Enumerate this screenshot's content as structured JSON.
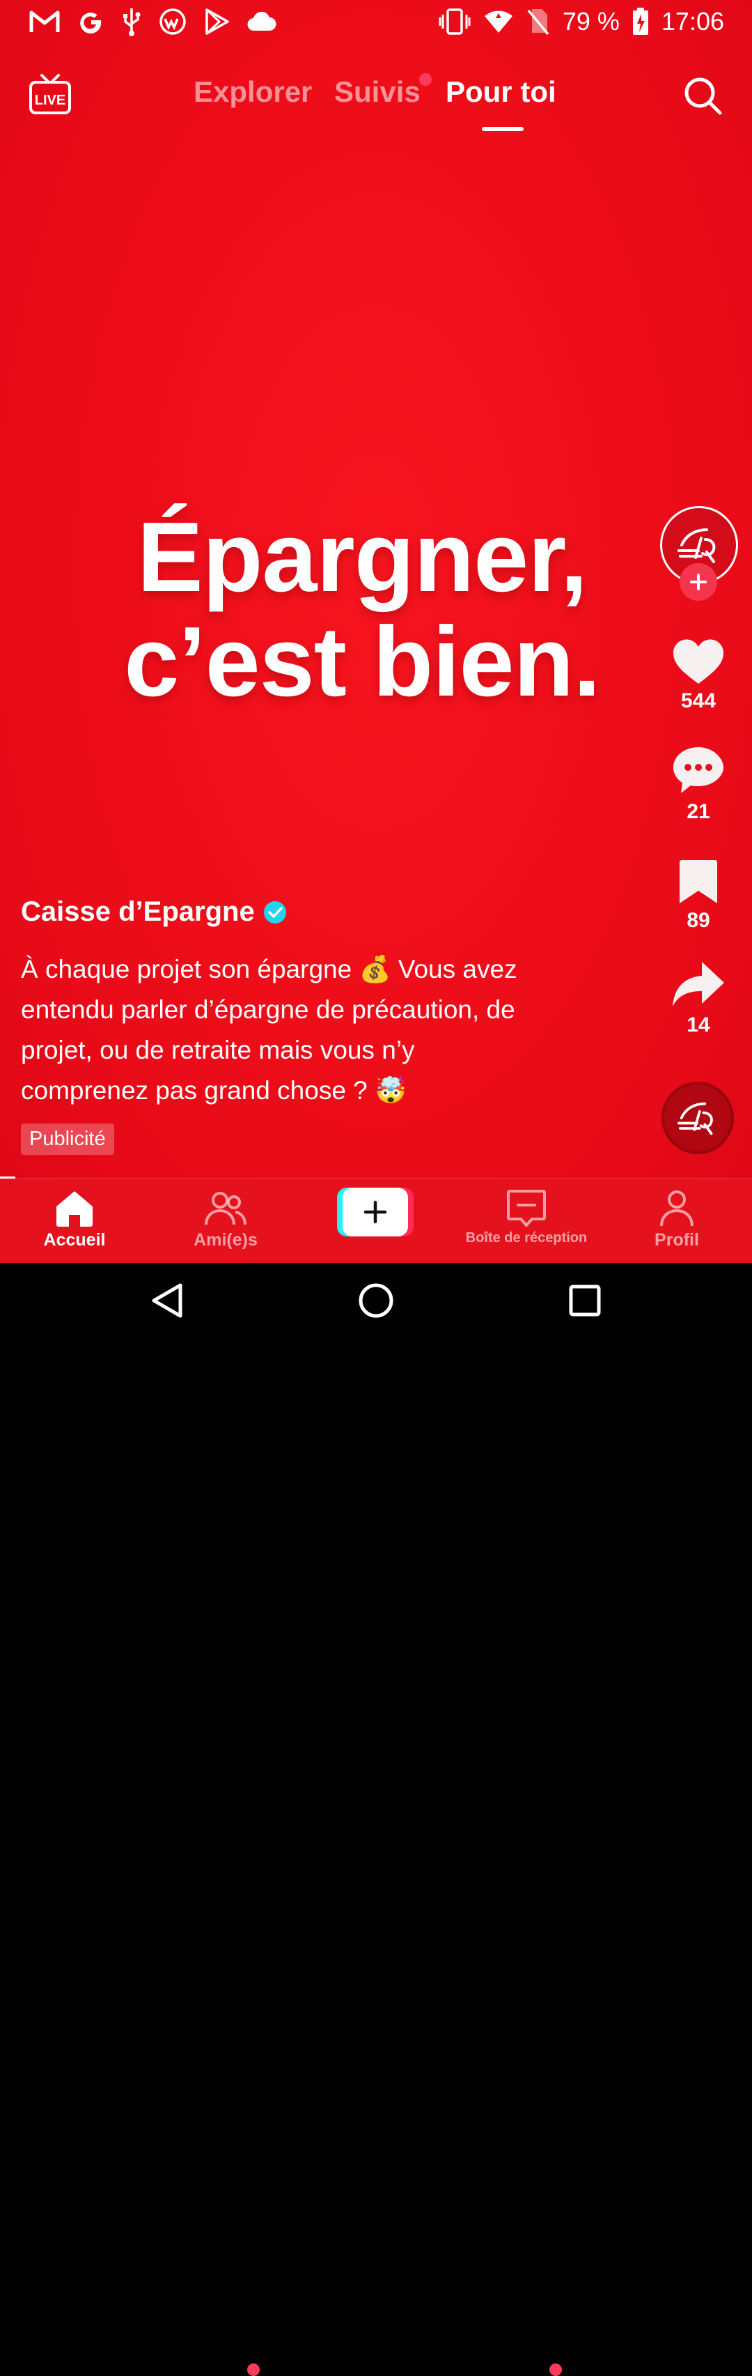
{
  "status_bar": {
    "left_icons": [
      "gmail-icon",
      "google-icon",
      "usb-icon",
      "app-icon",
      "play-store-icon",
      "cloud-icon"
    ],
    "battery": "79 %",
    "time": "17:06"
  },
  "top_nav": {
    "tabs": [
      {
        "label": "Explorer",
        "active": false
      },
      {
        "label": "Suivis",
        "active": false
      },
      {
        "label": "Pour toi",
        "active": true
      }
    ]
  },
  "video": {
    "headline_line1": "Épargner,",
    "headline_line2": "c’est bien."
  },
  "actions": {
    "likes": "544",
    "comments": "21",
    "saves": "89",
    "shares": "14"
  },
  "post": {
    "author": "Caisse d’Epargne",
    "caption_line1": "À chaque projet son épargne 💰 Vous avez",
    "caption_line2": "entendu parler d’épargne de précaution, de",
    "caption_line3": "projet, ou de retraite mais vous n’y",
    "caption_line4": "comprenez pas grand chose ? 🤯",
    "ad_label": "Publicité"
  },
  "bottom_nav": {
    "home": "Accueil",
    "friends": "Ami(e)s",
    "inbox": "Boîte de réception",
    "profile": "Profil"
  },
  "colors": {
    "background_red": "#ef0f1a",
    "accent_pink": "#fe2c55",
    "accent_cyan": "#25f4ee",
    "verified_blue": "#20d5ec"
  }
}
